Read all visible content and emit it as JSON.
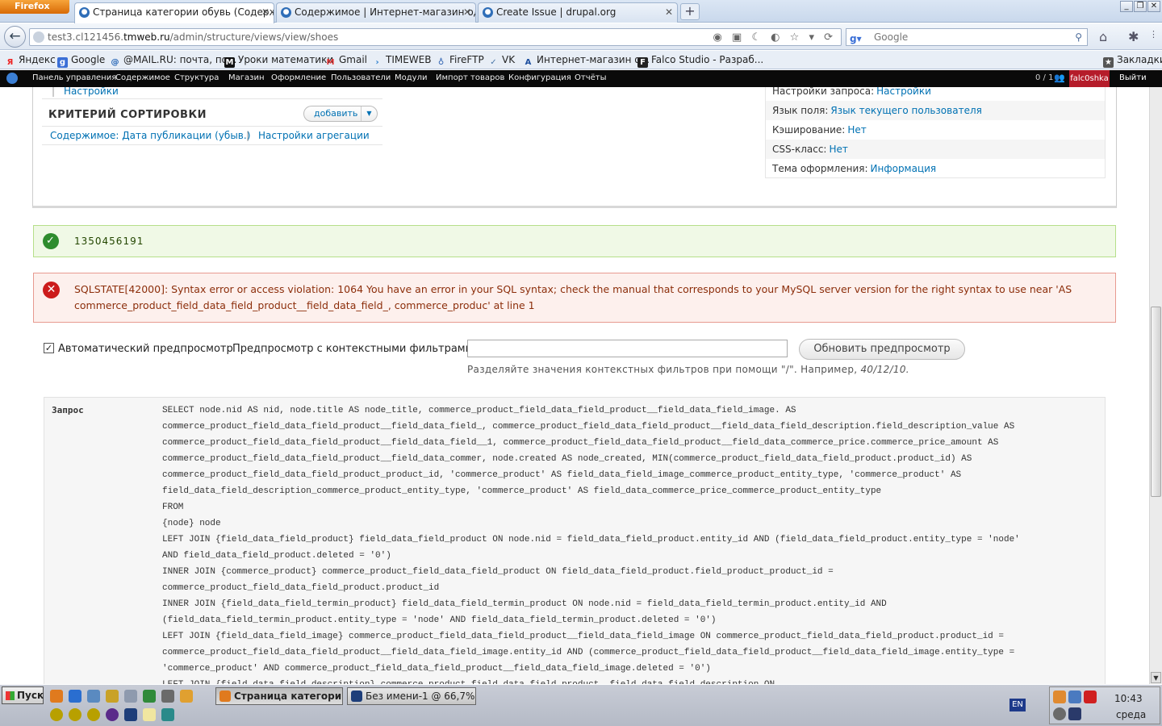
{
  "browser": {
    "menu_label": "Firefox",
    "tabs": [
      {
        "title": "Страница категории обувь (Содержимо...",
        "active": true
      },
      {
        "title": "Содержимое | Интернет-магазин одеж...",
        "active": false
      },
      {
        "title": "Create Issue | drupal.org",
        "active": false
      }
    ],
    "url_prefix": "test3.cl121456.",
    "url_host": "tmweb.ru",
    "url_path": "/admin/structure/views/view/shoes",
    "search_engine": "Google",
    "search_placeholder": "Google",
    "bookmarks": [
      {
        "label": "Яндекс",
        "icon": "yandex-icon"
      },
      {
        "label": "Google",
        "icon": "google-icon"
      },
      {
        "label": "@MAIL.RU: почта, по...",
        "icon": "mailru-icon"
      },
      {
        "label": "Уроки математики",
        "icon": "m-icon"
      },
      {
        "label": "Gmail",
        "icon": "gmail-icon"
      },
      {
        "label": "TIMEWEB",
        "icon": "timeweb-icon"
      },
      {
        "label": "FireFTP",
        "icon": "fireftp-icon"
      },
      {
        "label": "VK",
        "icon": "vk-icon"
      },
      {
        "label": "Интернет-магазин о...",
        "icon": "shop-icon"
      },
      {
        "label": "Falco Studio - Разраб...",
        "icon": "falco-icon"
      }
    ],
    "bookmarks_menu": "Закладки"
  },
  "toolbar": {
    "items": [
      "Панель управления",
      "Содержимое",
      "Структура",
      "Магазин",
      "Оформление",
      "Пользователи",
      "Модули",
      "Импорт товаров",
      "Конфигурация",
      "Отчёты"
    ],
    "count": "0 / 1",
    "user": "falc0shka",
    "logout": "Выйти"
  },
  "view": {
    "settings_link": "Настройки",
    "sort_title": "КРИТЕРИЙ СОРТИРОВКИ",
    "add_label": "добавить",
    "sort_item": "Содержимое: Дата публикации (убыв.)",
    "aggregation_link": "Настройки агрегации",
    "right_rows": [
      {
        "label": "Настройки запроса:",
        "value": "Настройки"
      },
      {
        "label": "Язык поля:",
        "value": "Язык текущего пользователя"
      },
      {
        "label": "Кэширование:",
        "value": "Нет"
      },
      {
        "label": "CSS-класс:",
        "value": "Нет"
      },
      {
        "label": "Тема оформления:",
        "value": "Информация"
      }
    ]
  },
  "messages": {
    "status": "1350456191",
    "error_line1": "SQLSTATE[42000]: Syntax error or access violation: 1064 You have an error in your SQL syntax; check the manual that corresponds to your MySQL server version for the right syntax to use near 'AS",
    "error_line2": "commerce_product_field_data_field_product__field_data_field_, commerce_produc' at line 1"
  },
  "preview": {
    "auto_label": "Автоматический предпросмотр",
    "auto_checked": true,
    "ctx_label": "Предпросмотр с контекстными фильтрами:",
    "ctx_value": "",
    "update_button": "Обновить предпросмотр",
    "hint_text": "Разделяйте значения контекстных фильтров при помощи \"/\". Например, ",
    "hint_example": "40/12/10."
  },
  "query": {
    "label": "Запрос",
    "lines": [
      "SELECT node.nid AS nid, node.title AS node_title, commerce_product_field_data_field_product__field_data_field_image. AS",
      "commerce_product_field_data_field_product__field_data_field_, commerce_product_field_data_field_product__field_data_field_description.field_description_value AS",
      "commerce_product_field_data_field_product__field_data_field__1, commerce_product_field_data_field_product__field_data_commerce_price.commerce_price_amount AS",
      "commerce_product_field_data_field_product__field_data_commer, node.created AS node_created, MIN(commerce_product_field_data_field_product.product_id) AS",
      "commerce_product_field_data_field_product_product_id, 'commerce_product' AS field_data_field_image_commerce_product_entity_type, 'commerce_product' AS",
      "field_data_field_description_commerce_product_entity_type, 'commerce_product' AS field_data_commerce_price_commerce_product_entity_type",
      "FROM",
      "{node} node",
      "LEFT JOIN {field_data_field_product} field_data_field_product ON node.nid = field_data_field_product.entity_id AND (field_data_field_product.entity_type = 'node'",
      "AND field_data_field_product.deleted = '0')",
      "INNER JOIN {commerce_product} commerce_product_field_data_field_product ON field_data_field_product.field_product_product_id =",
      "commerce_product_field_data_field_product.product_id",
      "INNER JOIN {field_data_field_termin_product} field_data_field_termin_product ON node.nid = field_data_field_termin_product.entity_id AND",
      "(field_data_field_termin_product.entity_type = 'node' AND field_data_field_termin_product.deleted = '0')",
      "LEFT JOIN {field_data_field_image} commerce_product_field_data_field_product__field_data_field_image ON commerce_product_field_data_field_product.product_id =",
      "commerce_product_field_data_field_product__field_data_field_image.entity_id AND (commerce_product_field_data_field_product__field_data_field_image.entity_type =",
      "'commerce_product' AND commerce_product_field_data_field_product__field_data_field_image.deleted = '0')",
      "LEFT JOIN {field_data_field_description} commerce_product_field_data_field_product__field_data_field_description ON"
    ]
  },
  "taskbar": {
    "start": "Пуск",
    "tasks": [
      {
        "label": "Страница категори...",
        "active": true
      },
      {
        "label": "Без имени-1 @ 66,7% (С...",
        "active": false
      }
    ],
    "lang": "EN",
    "time": "10:43",
    "day": "среда"
  }
}
